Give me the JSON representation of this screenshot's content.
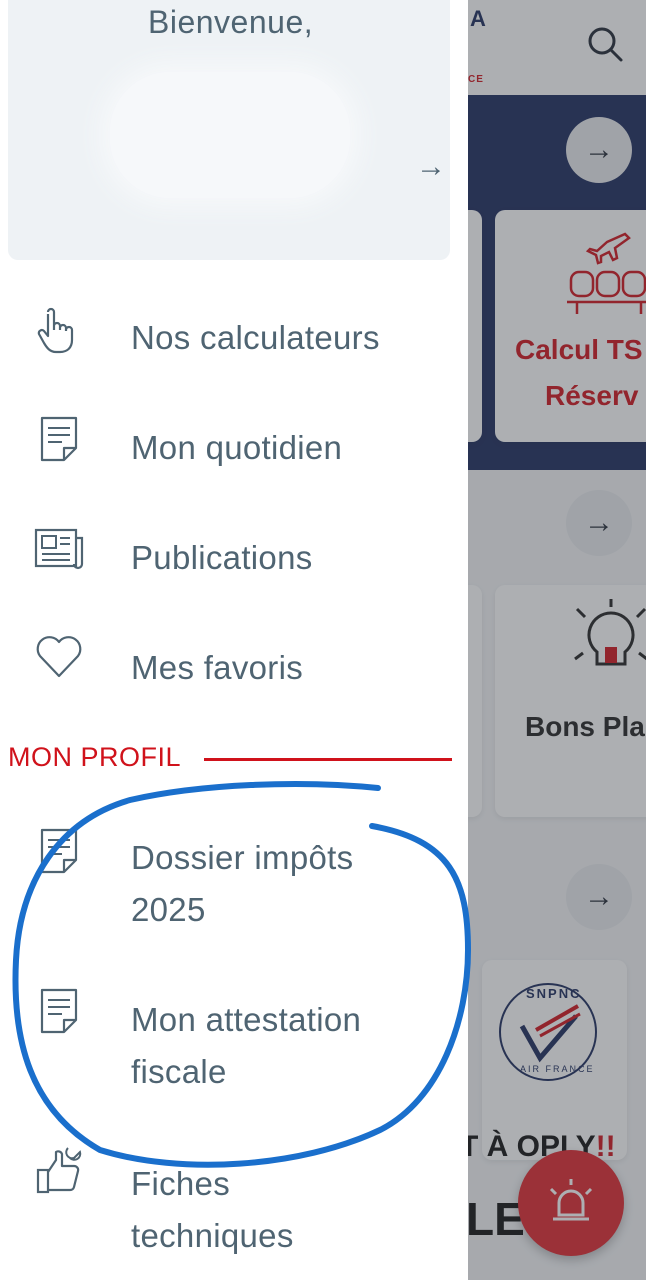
{
  "background": {
    "logo_letter": "A",
    "logo_sub": "CE",
    "card1_line1": "Calcul TS",
    "card1_line2": "Réserv",
    "card2_title": "Bons Pla",
    "banner_line1_a": "T À OPLY",
    "banner_line1_b": "!!",
    "banner_line2": "LE",
    "arrow": "→",
    "logo_badge_top": "SNPNC",
    "logo_badge_bottom": "AIR FRANCE"
  },
  "drawer": {
    "welcome": "Bienvenue,",
    "welcome_arrow": "→",
    "menu": [
      {
        "label": "Nos calculateurs",
        "icon": "pointing-hand-icon"
      },
      {
        "label": "Mon quotidien",
        "icon": "document-icon"
      },
      {
        "label": "Publications",
        "icon": "newspaper-icon"
      },
      {
        "label": "Mes favoris",
        "icon": "heart-icon"
      }
    ],
    "profile_section": "MON PROFIL",
    "profile_menu": [
      {
        "line1": "Dossier impôts",
        "line2": "2025",
        "icon": "document-icon"
      },
      {
        "line1": "Mon attestation",
        "line2": "fiscale",
        "icon": "document-icon"
      },
      {
        "line1": "Fiches",
        "line2": "techniques",
        "icon": "thumbs-up-wrench-icon"
      }
    ]
  },
  "colors": {
    "accent_red": "#d0121b",
    "text_slate": "#4f6472",
    "navy": "#1b2a5c",
    "annotation_blue": "#1a6fcc"
  }
}
